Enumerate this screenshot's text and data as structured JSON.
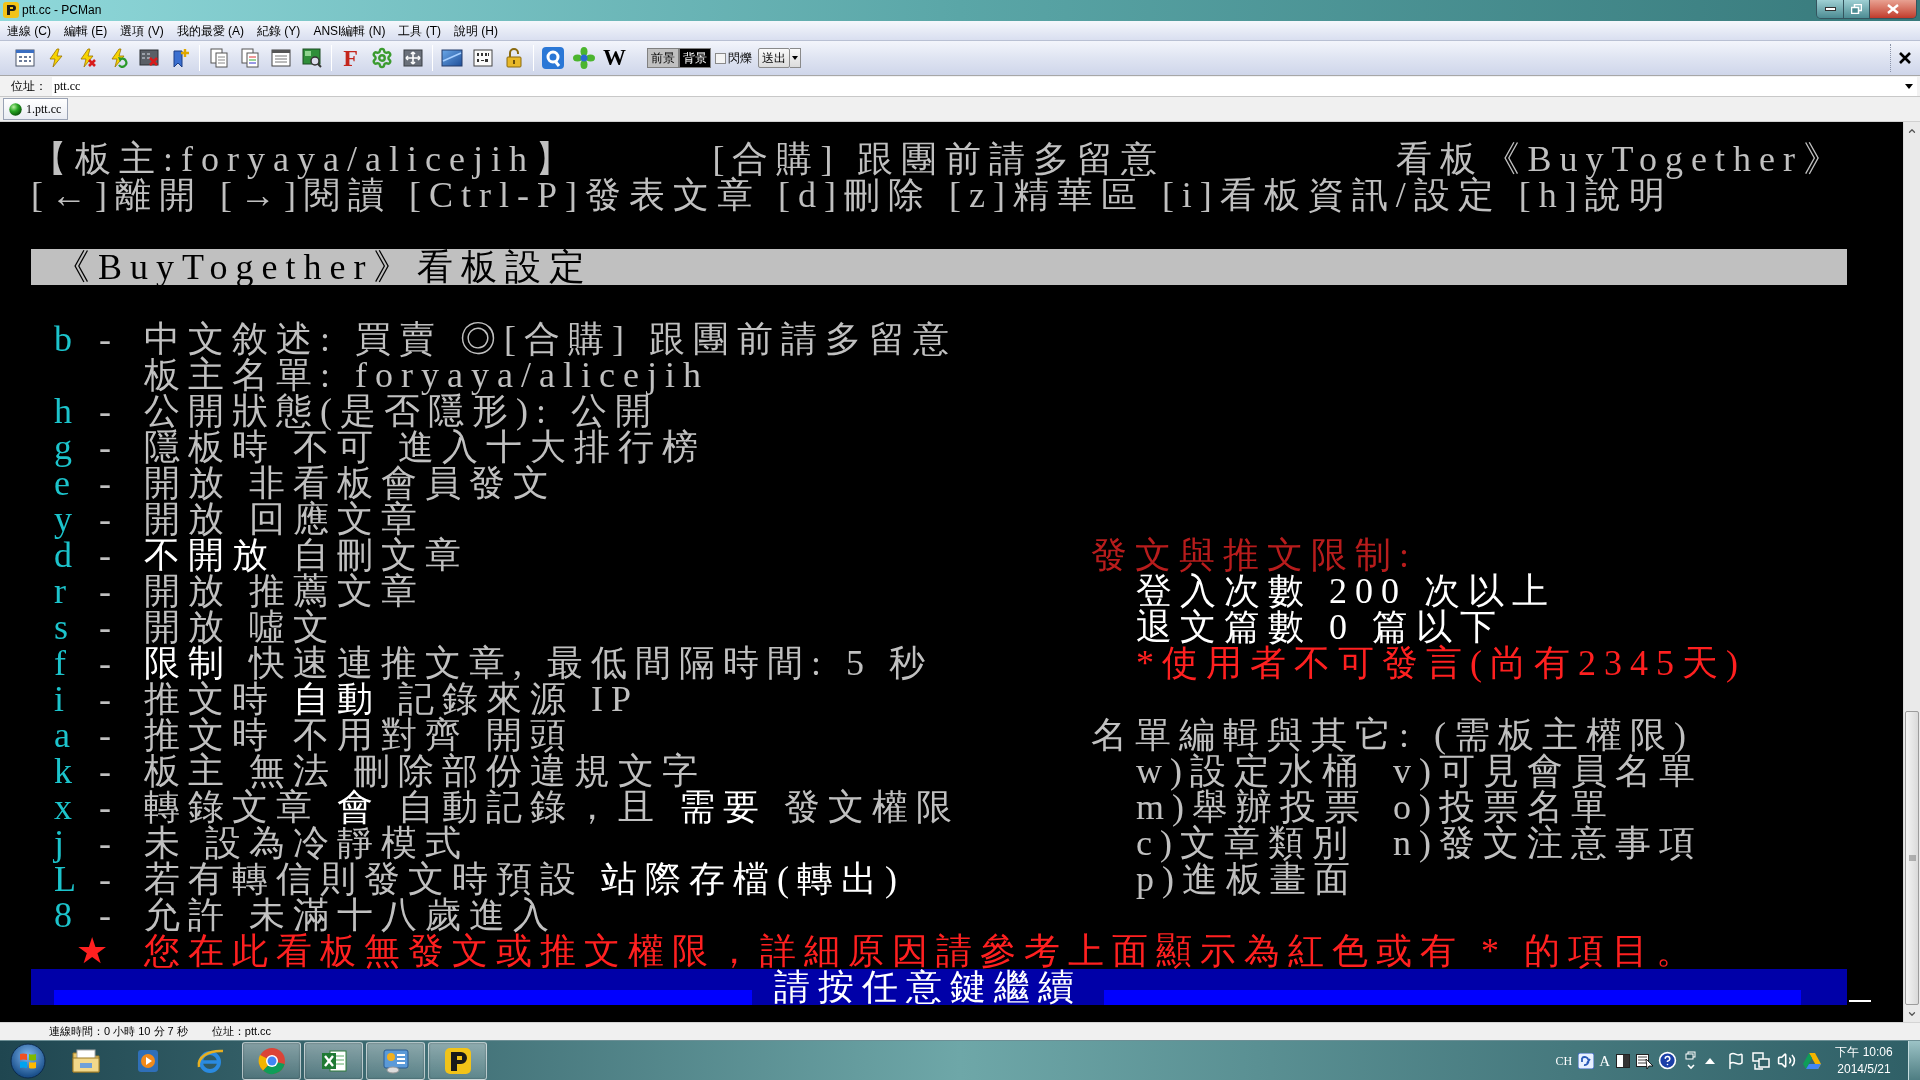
{
  "window": {
    "title": "ptt.cc - PCMan"
  },
  "menu": [
    "連線 (C)",
    "編輯 (E)",
    "選項 (V)",
    "我的最愛 (A)",
    "紀錄 (Y)",
    "ANSI編輯 (N)",
    "工具 (T)",
    "說明 (H)"
  ],
  "toolbar": {
    "font_button": "F",
    "web_button": "W",
    "foreground": "前景",
    "background": "背景",
    "blink": {
      "label": "閃爍",
      "checked": false
    },
    "send": "送出"
  },
  "address": {
    "label": "位址：",
    "value": "ptt.cc"
  },
  "tabs": [
    {
      "label": "1.ptt.cc",
      "selected": true
    }
  ],
  "terminal": {
    "header": {
      "moderators": "【板主:foryaya/alicejih】",
      "title": "[合購] 跟團前請多留意",
      "board": "看板《BuyTogether》"
    },
    "commands": "[←]離開 [→]閱讀 [Ctrl-P]發表文章 [d]刪除 [z]精華區 [i]看板資訊/設定 [h]說明",
    "section_title": "《BuyTogether》看板設定",
    "settings": [
      {
        "key": "b",
        "sep": "-",
        "text": "中文敘述: 買賣 ◎[合購] 跟團前請多留意"
      },
      {
        "text": "板主名單: foryaya/alicejih"
      },
      {
        "key": "h",
        "sep": "-",
        "text": "公開狀態(是否隱形): 公開"
      },
      {
        "key": "g",
        "sep": "-",
        "text": "隱板時 不可 進入十大排行榜"
      },
      {
        "key": "e",
        "sep": "-",
        "text": "開放 非看板會員發文"
      },
      {
        "key": "y",
        "sep": "-",
        "text": "開放 回應文章"
      },
      {
        "key": "d",
        "sep": "-",
        "text": "**不開放** 自刪文章"
      },
      {
        "key": "r",
        "sep": "-",
        "text": "開放 推薦文章"
      },
      {
        "key": "s",
        "sep": "-",
        "text": "開放 噓文"
      },
      {
        "key": "f",
        "sep": "-",
        "text": "**限制** 快速連推文章, 最低間隔時間: 5 秒"
      },
      {
        "key": "i",
        "sep": "-",
        "text": "推文時 **自動** 記錄來源 IP"
      },
      {
        "key": "a",
        "sep": "-",
        "text": "推文時 不用對齊 開頭"
      },
      {
        "key": "k",
        "sep": "-",
        "text": "板主 無法 刪除部份違規文字"
      },
      {
        "key": "x",
        "sep": "-",
        "text": "轉錄文章 **會** 自動記錄，且 **需要** 發文權限"
      },
      {
        "key": "j",
        "sep": "-",
        "text": "未 設為冷靜模式"
      },
      {
        "key": "L",
        "sep": "-",
        "text": "若有轉信則發文時預設 **站際存檔(轉出)**"
      },
      {
        "key": "8",
        "sep": "-",
        "text": "允許 未滿十八歲進入"
      }
    ],
    "restrictions": {
      "title": "發文與推文限制:",
      "items": [
        {
          "text": "登入次數 200 次以上",
          "warning": false
        },
        {
          "text": "退文篇數 0 篇以下",
          "warning": false
        },
        {
          "text": "*使用者不可發言(尚有2345天)",
          "warning": true
        }
      ]
    },
    "admin": {
      "title": "名單編輯與其它: (需板主權限)",
      "rows": [
        [
          "w)設定水桶",
          "v)可見會員名單"
        ],
        [
          "m)舉辦投票",
          "o)投票名單"
        ],
        [
          "c)文章類別",
          "n)發文注意事項"
        ],
        [
          "p)進板畫面"
        ]
      ]
    },
    "notice": {
      "mark": "★",
      "text": "您在此看板無發文或推文權限，詳細原因請參考上面顯示為紅色或有 * 的項目。"
    },
    "prompt": "請按任意鍵繼續"
  },
  "status_bar": {
    "connection_time": "連線時間：0 小時 10 分 7 秒",
    "address": "位址：ptt.cc"
  },
  "taskbar": {
    "apps": [
      {
        "kind": "folder",
        "running": false
      },
      {
        "kind": "player",
        "running": false
      },
      {
        "kind": "browser",
        "running": false
      },
      {
        "kind": "globe",
        "running": true
      },
      {
        "kind": "spreadsheet",
        "running": true
      },
      {
        "kind": "dashboard",
        "running": true
      },
      {
        "kind": "terminal",
        "running": true
      }
    ],
    "tray": {
      "language": "CH",
      "input_mode": "A"
    },
    "clock": {
      "time": "下午 10:06",
      "date": "2014/5/21"
    }
  }
}
